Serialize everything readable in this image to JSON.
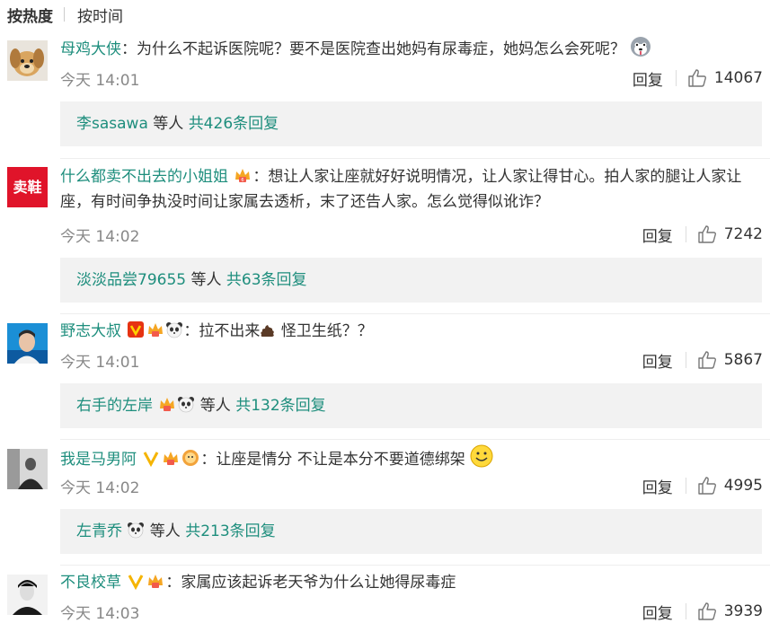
{
  "sort": {
    "hot": "按热度",
    "time": "按时间"
  },
  "comments": [
    {
      "user": "母鸡大侠",
      "text": "：为什么不起诉医院呢？要不是医院查出她妈有尿毒症，她妈怎么会死呢？",
      "time": "今天 14:01",
      "reply_label": "回复",
      "likes": "14067",
      "replies": {
        "name": "李sasawa",
        "mid": " 等人 ",
        "count": "共426条回复"
      }
    },
    {
      "user": "什么都卖不出去的小姐姐",
      "text": "：想让人家让座就好好说明情况，让人家让得甘心。拍人家的腿让人家让座，有时间争执没时间让家属去透析，末了还告人家。怎么觉得似讹诈？",
      "time": "今天 14:02",
      "reply_label": "回复",
      "likes": "7242",
      "avatar_text": "卖鞋",
      "replies": {
        "name": "淡淡品尝79655",
        "mid": " 等人 ",
        "count": "共63条回复"
      }
    },
    {
      "user": "野志大叔",
      "text": "：拉不出来",
      "text2": " 怪卫生纸？？",
      "time": "今天 14:01",
      "reply_label": "回复",
      "likes": "5867",
      "replies": {
        "name": "右手的左岸",
        "mid": " 等人 ",
        "count": "共132条回复"
      }
    },
    {
      "user": "我是马男阿",
      "text": "：让座是情分 不让是本分不要道德绑架",
      "time": "今天 14:02",
      "reply_label": "回复",
      "likes": "4995",
      "replies": {
        "name": "左青乔",
        "mid": " 等人 ",
        "count": "共213条回复"
      }
    },
    {
      "user": "不良校草",
      "text": "：家属应该起诉老天爷为什么让她得尿毒症",
      "time": "今天 14:03",
      "reply_label": "回复",
      "likes": "3939"
    }
  ],
  "colors": {
    "username": "#1e8e7d",
    "reply_bg": "#f2f2f2",
    "meta": "#888888"
  }
}
